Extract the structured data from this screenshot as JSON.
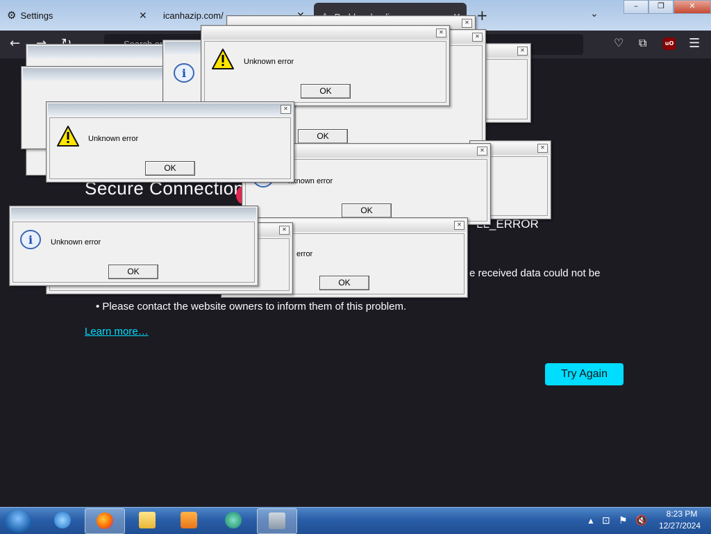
{
  "browser": {
    "tabs": [
      {
        "label": "Settings"
      },
      {
        "label": "icanhazip.com/"
      },
      {
        "label": "Problem loading page"
      }
    ],
    "new_tab_symbol": "+",
    "tab_list_symbol": "⌄",
    "url_placeholder": "Search or enter address",
    "ublock_badge": "uO",
    "window_controls": {
      "minimize": "–",
      "maximize": "❐",
      "close": "✕"
    }
  },
  "error_page": {
    "title": "Secure Connection",
    "error_code": "LL_ERROR",
    "description_fragment": "e received data could not be",
    "bullet": "Please contact the website owners to inform them of this problem.",
    "learn_more": "Learn more…",
    "try_again": "Try Again"
  },
  "dialogs": [
    {
      "message": "Unknown error",
      "button": "OK",
      "icon": "warning-icon"
    },
    {
      "message": "Unknown error",
      "button": "OK",
      "icon": "warning-icon"
    },
    {
      "message": "Unknown error",
      "button": "OK",
      "icon": "info-icon"
    },
    {
      "message": "nknown error",
      "button": "OK",
      "icon": "info-icon"
    },
    {
      "message": "error",
      "button": "OK",
      "icon": "info-icon"
    },
    {
      "message": "",
      "button": "OK",
      "icon": ""
    }
  ],
  "taskbar": {
    "apps": [
      "internet-explorer",
      "firefox",
      "file-explorer",
      "media-player",
      "chat-app",
      "tool-app"
    ],
    "clock_time": "8:23 PM",
    "clock_date": "12/27/2024"
  },
  "colors": {
    "page_bg": "#1c1b22",
    "accent": "#00ddff",
    "taskbar": "#2a5ea7"
  }
}
